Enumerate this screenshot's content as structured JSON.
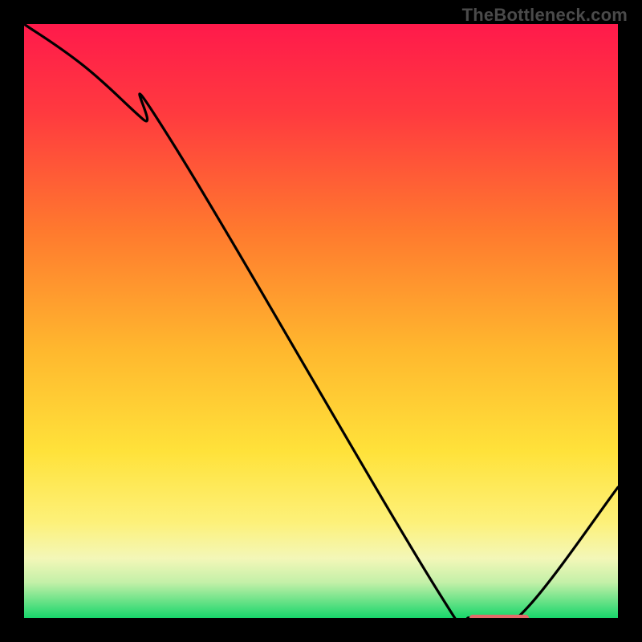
{
  "watermark": "TheBottleneck.com",
  "chart_data": {
    "type": "line",
    "title": "",
    "xlabel": "",
    "ylabel": "",
    "xlim": [
      0,
      100
    ],
    "ylim": [
      0,
      100
    ],
    "grid": false,
    "legend": null,
    "series": [
      {
        "name": "curve",
        "x": [
          0,
          10,
          20,
          25,
          70,
          75,
          80,
          85,
          100
        ],
        "y": [
          100,
          93,
          84,
          80,
          4,
          0,
          0,
          2,
          22
        ]
      }
    ],
    "marker": {
      "x_start": 75,
      "x_end": 85,
      "y": 0,
      "color": "#e46a6a",
      "thickness_px": 8
    },
    "annotations": [],
    "gradient_stops": [
      {
        "offset": 0.0,
        "color": "#ff1a4b"
      },
      {
        "offset": 0.15,
        "color": "#ff3a3f"
      },
      {
        "offset": 0.35,
        "color": "#ff7a2e"
      },
      {
        "offset": 0.55,
        "color": "#ffb82e"
      },
      {
        "offset": 0.72,
        "color": "#ffe23a"
      },
      {
        "offset": 0.84,
        "color": "#fdf17a"
      },
      {
        "offset": 0.9,
        "color": "#f3f7b8"
      },
      {
        "offset": 0.94,
        "color": "#c4f0a8"
      },
      {
        "offset": 1.0,
        "color": "#18d66b"
      }
    ]
  }
}
